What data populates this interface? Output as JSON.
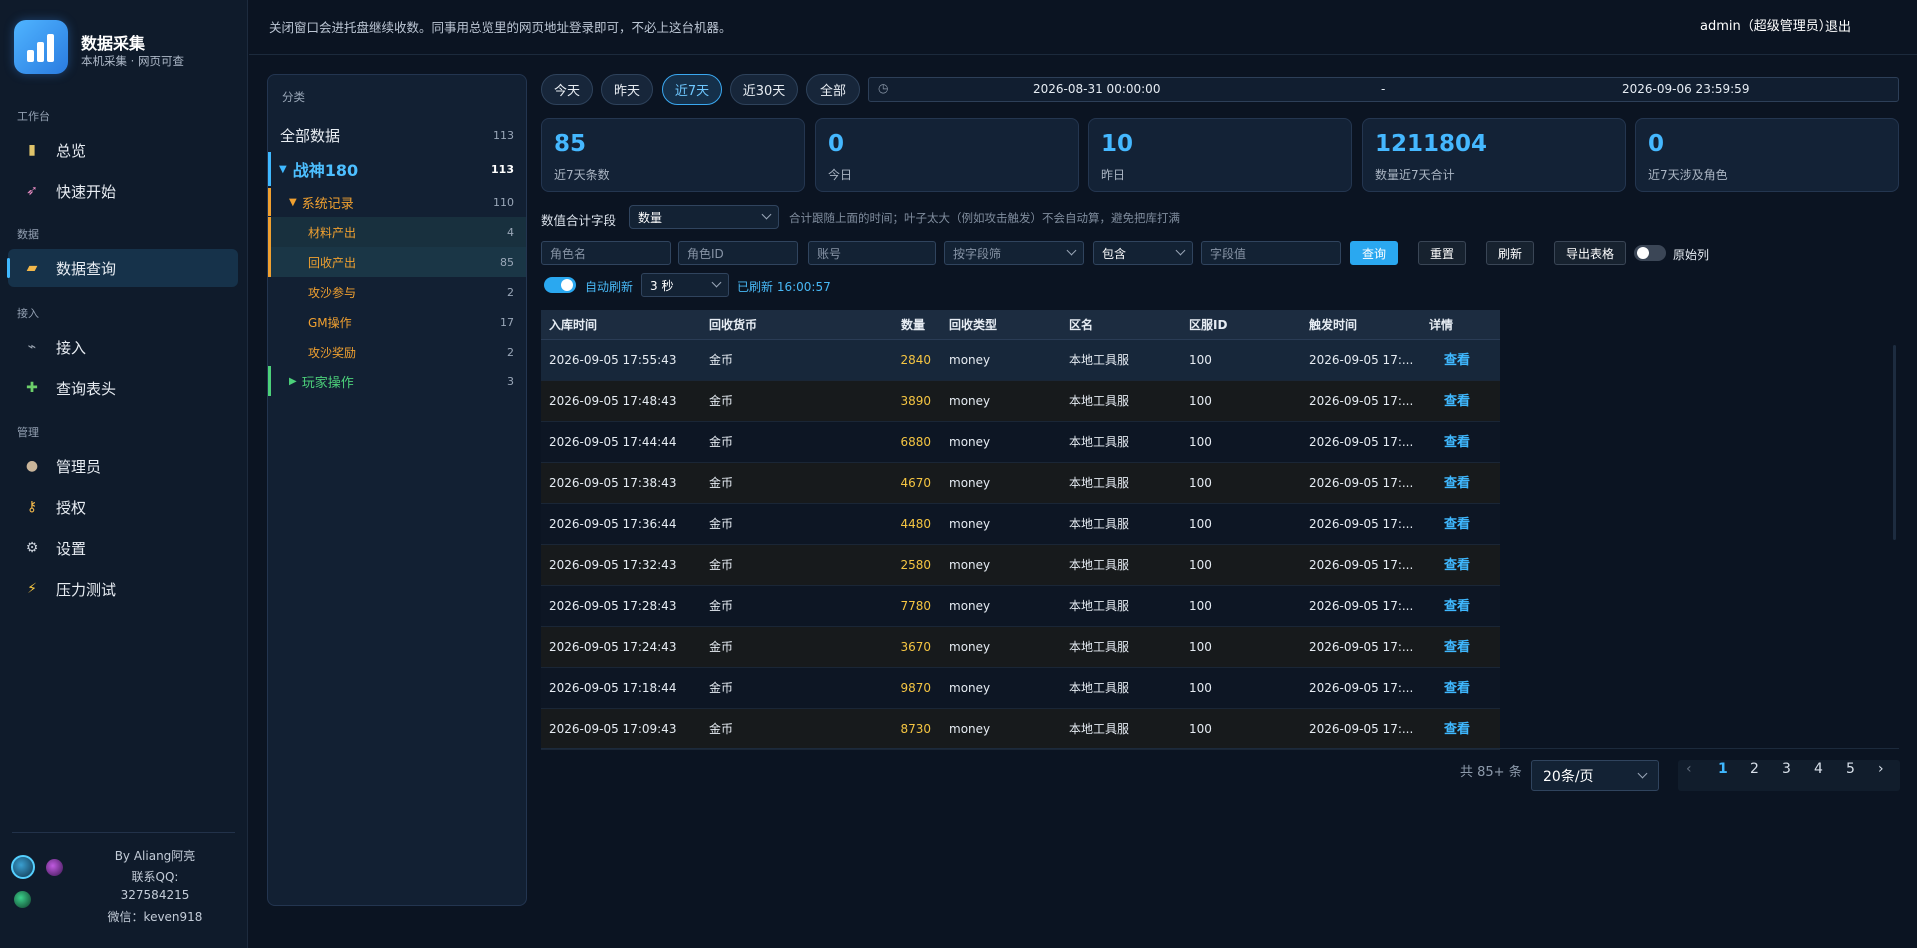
{
  "app": {
    "title": "数据采集",
    "subtitle": "本机采集 · 网页可查"
  },
  "sidebar": {
    "sections": {
      "workbench": "工作台",
      "data": "数据",
      "access": "接入",
      "manage": "管理"
    },
    "items": [
      {
        "label": "总览",
        "icon": "chart-icon"
      },
      {
        "label": "快速开始",
        "icon": "rocket-icon"
      },
      {
        "label": "数据查询",
        "icon": "folder-icon"
      },
      {
        "label": "接入",
        "icon": "plug-icon"
      },
      {
        "label": "查询表头",
        "icon": "puzzle-icon"
      },
      {
        "label": "管理员",
        "icon": "user-icon"
      },
      {
        "label": "授权",
        "icon": "key-icon"
      },
      {
        "label": "设置",
        "icon": "gear-icon"
      },
      {
        "label": "压力测试",
        "icon": "bolt-icon"
      }
    ],
    "credit": {
      "by": "By Aliang阿亮",
      "qq_label": "联系QQ:",
      "qq": "327584215",
      "wechat": "微信：keven918"
    }
  },
  "header": {
    "notice": "关闭窗口会进托盘继续收数。同事用总览里的网页地址登录即可，不必上这台机器。",
    "user": "admin（超级管理员）",
    "logout": "退出"
  },
  "categories": {
    "title": "分类",
    "all": {
      "label": "全部数据",
      "count": "113"
    },
    "game": {
      "label": "战神180",
      "count": "113"
    },
    "system": {
      "label": "系统记录",
      "count": "110"
    },
    "children": [
      {
        "label": "材料产出",
        "count": "4"
      },
      {
        "label": "回收产出",
        "count": "85"
      },
      {
        "label": "攻沙参与",
        "count": "2"
      },
      {
        "label": "GM操作",
        "count": "17"
      },
      {
        "label": "攻沙奖励",
        "count": "2"
      }
    ],
    "player": {
      "label": "玩家操作",
      "count": "3"
    }
  },
  "ranges": {
    "today": "今天",
    "yesterday": "昨天",
    "last7": "近7天",
    "last30": "近30天",
    "all": "全部"
  },
  "daterange": {
    "start": "2026-08-31 00:00:00",
    "sep": "-",
    "end": "2026-09-06 23:59:59"
  },
  "stats": [
    {
      "value": "85",
      "label": "近7天条数"
    },
    {
      "value": "0",
      "label": "今日"
    },
    {
      "value": "10",
      "label": "昨日"
    },
    {
      "value": "1211804",
      "label": "数量近7天合计"
    },
    {
      "value": "0",
      "label": "近7天涉及角色"
    }
  ],
  "sum": {
    "label": "数值合计字段",
    "value": "数量",
    "hint": "合计跟随上面的时间；叶子太大（例如攻击触发）不会自动算，避免把库打满"
  },
  "filters": {
    "role_name": "角色名",
    "role_id": "角色ID",
    "account": "账号",
    "field_filter": "按字段筛",
    "op": "包含",
    "field_value": "字段值",
    "query": "查询",
    "reset": "重置",
    "refresh": "刷新",
    "export": "导出表格",
    "raw": "原始列"
  },
  "autorefresh": {
    "label": "自动刷新",
    "interval": "3 秒",
    "status": "已刷新 16:00:57"
  },
  "table": {
    "columns": [
      "入库时间",
      "回收货币",
      "数量",
      "回收类型",
      "区名",
      "区服ID",
      "触发时间",
      "详情"
    ],
    "rows": [
      {
        "time": "2026-09-05 17:55:43",
        "cur": "金币",
        "qty": "2840",
        "type": "money",
        "zone": "本地工具服",
        "zid": "100",
        "trig": "2026-09-05 17:...",
        "act": "查看"
      },
      {
        "time": "2026-09-05 17:48:43",
        "cur": "金币",
        "qty": "3890",
        "type": "money",
        "zone": "本地工具服",
        "zid": "100",
        "trig": "2026-09-05 17:...",
        "act": "查看"
      },
      {
        "time": "2026-09-05 17:44:44",
        "cur": "金币",
        "qty": "6880",
        "type": "money",
        "zone": "本地工具服",
        "zid": "100",
        "trig": "2026-09-05 17:...",
        "act": "查看"
      },
      {
        "time": "2026-09-05 17:38:43",
        "cur": "金币",
        "qty": "4670",
        "type": "money",
        "zone": "本地工具服",
        "zid": "100",
        "trig": "2026-09-05 17:...",
        "act": "查看"
      },
      {
        "time": "2026-09-05 17:36:44",
        "cur": "金币",
        "qty": "4480",
        "type": "money",
        "zone": "本地工具服",
        "zid": "100",
        "trig": "2026-09-05 17:...",
        "act": "查看"
      },
      {
        "time": "2026-09-05 17:32:43",
        "cur": "金币",
        "qty": "2580",
        "type": "money",
        "zone": "本地工具服",
        "zid": "100",
        "trig": "2026-09-05 17:...",
        "act": "查看"
      },
      {
        "time": "2026-09-05 17:28:43",
        "cur": "金币",
        "qty": "7780",
        "type": "money",
        "zone": "本地工具服",
        "zid": "100",
        "trig": "2026-09-05 17:...",
        "act": "查看"
      },
      {
        "time": "2026-09-05 17:24:43",
        "cur": "金币",
        "qty": "3670",
        "type": "money",
        "zone": "本地工具服",
        "zid": "100",
        "trig": "2026-09-05 17:...",
        "act": "查看"
      },
      {
        "time": "2026-09-05 17:18:44",
        "cur": "金币",
        "qty": "9870",
        "type": "money",
        "zone": "本地工具服",
        "zid": "100",
        "trig": "2026-09-05 17:...",
        "act": "查看"
      },
      {
        "time": "2026-09-05 17:09:43",
        "cur": "金币",
        "qty": "8730",
        "type": "money",
        "zone": "本地工具服",
        "zid": "100",
        "trig": "2026-09-05 17:...",
        "act": "查看"
      }
    ]
  },
  "pagination": {
    "total": "共 85+ 条",
    "page_size": "20条/页",
    "pages": [
      "1",
      "2",
      "3",
      "4",
      "5"
    ],
    "prev": "‹",
    "next": "›"
  },
  "colors": {
    "accent": "#3fb8ff",
    "gold": "#f5c542",
    "orange": "#f0a030",
    "green": "#4cd17a"
  }
}
